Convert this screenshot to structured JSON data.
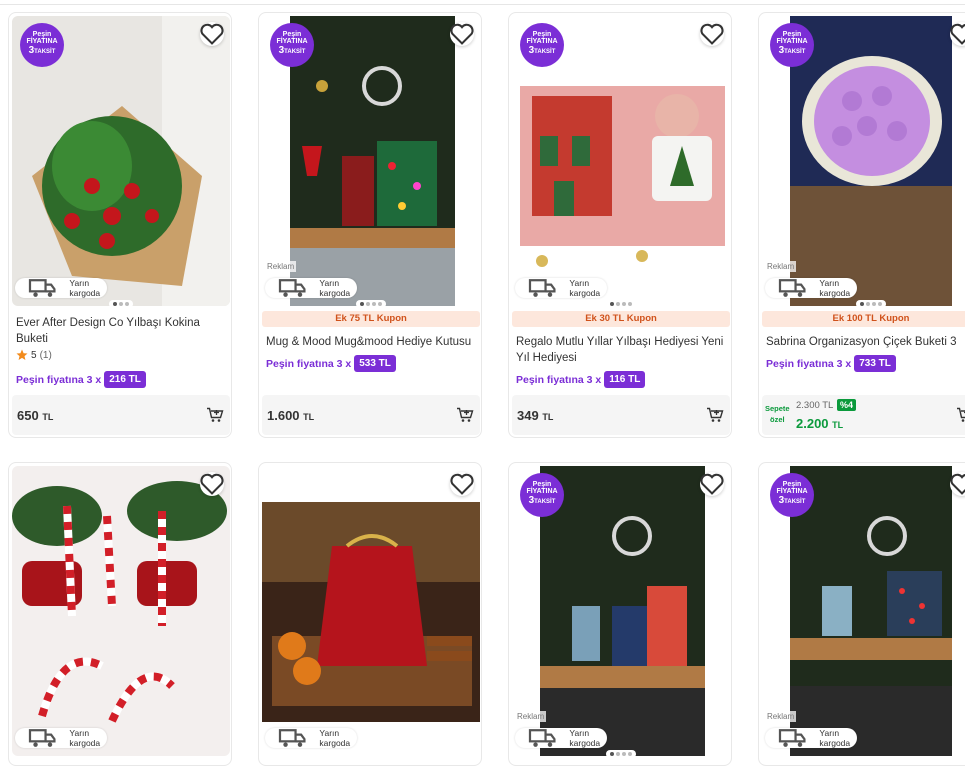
{
  "colors": {
    "purple": "#7b2ed6",
    "coupon_bg": "#fde7dc",
    "coupon_text": "#d0521b",
    "green": "#0b9a3c"
  },
  "badge": {
    "line1": "Peşin",
    "line2": "FİYATINA",
    "line3": "3",
    "line3_small": "TAKSİT"
  },
  "common": {
    "cargo": "Yarın kargoda",
    "ad": "Reklam",
    "installment_prefix": "Peşin fiyatına 3 x",
    "currency": "TL"
  },
  "products": [
    {
      "title": "Ever After Design Co Yılbaşı Kokina Buketi",
      "rating": "5",
      "rating_count": "(1)",
      "installment": "216 TL",
      "price": "650"
    },
    {
      "coupon": "Ek 75 TL Kupon",
      "title": "Mug & Mood Mug&mood Hediye Kutusu",
      "installment": "533 TL",
      "price": "1.600"
    },
    {
      "coupon": "Ek 30 TL Kupon",
      "title": "Regalo Mutlu Yıllar Yılbaşı Hediyesi Yeni Yıl Hediyesi",
      "installment": "116 TL",
      "price": "349"
    },
    {
      "coupon": "Ek 100 TL Kupon",
      "title": "Sabrina Organizasyon Çiçek Buketi 3",
      "installment": "733 TL",
      "basket_label_1": "Sepete",
      "basket_label_2": "özel",
      "old_price": "2.300 TL",
      "discount": "%4",
      "price": "2.200"
    }
  ]
}
